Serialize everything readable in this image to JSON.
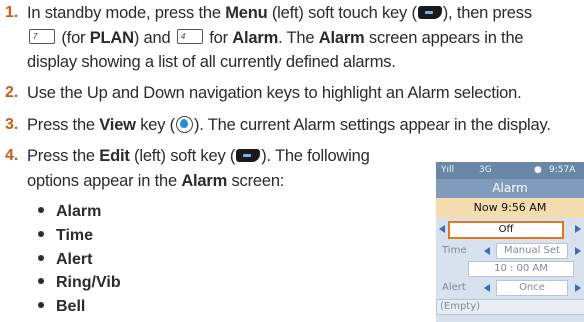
{
  "steps": [
    {
      "num": "1.",
      "l1a": "In standby mode, press the ",
      "l1b": "Menu",
      "l1c": " (left) soft touch key (",
      "l1d": "), then press",
      "key7": "7",
      "l2b": " (for ",
      "l2c": "PLAN",
      "l2d": ") and ",
      "key4": "4",
      "l2e": " for ",
      "l2f": "Alarm",
      "l2g": ". The ",
      "l2h": "Alarm",
      "l2i": " screen appears in the",
      "l3": "display showing a list of all currently defined alarms."
    },
    {
      "num": "2.",
      "l1": "Use the Up and Down navigation keys to highlight an Alarm selection."
    },
    {
      "num": "3.",
      "l1a": "Press the ",
      "l1b": "View",
      "l1c": " key (",
      "l1d": "). The current Alarm settings appear in the display."
    },
    {
      "num": "4.",
      "l1a": "Press the ",
      "l1b": "Edit",
      "l1c": " (left) soft key (",
      "l1d": "). The following",
      "l2": "options appear in the ",
      "l2b": "Alarm",
      "l2c": " screen:"
    }
  ],
  "bullets": [
    "Alarm",
    "Time",
    "Alert",
    "Ring/Vib",
    "Bell"
  ],
  "icons": {
    "soft_key": "left-soft-key-icon",
    "ok_key": "ok-key-icon",
    "key7": "key-7-icon",
    "key4": "key-4-icon"
  },
  "phone": {
    "signal": "Yıll",
    "network": "3G",
    "clock": "9:57A",
    "title": "Alarm",
    "now": "Now 9:56 AM",
    "alarm_value": "Off",
    "time_label": "Time",
    "time_value": "Manual Set",
    "time_display": "10 : 00 AM",
    "alert_label": "Alert",
    "alert_value": "Once",
    "empty": "(Empty)"
  },
  "colors": {
    "step_number": "#c4601a",
    "status_bar": "#6a87a6",
    "title_bar": "#7f9cbc",
    "highlight": "#f3dcae",
    "selection_border": "#e07a12"
  }
}
